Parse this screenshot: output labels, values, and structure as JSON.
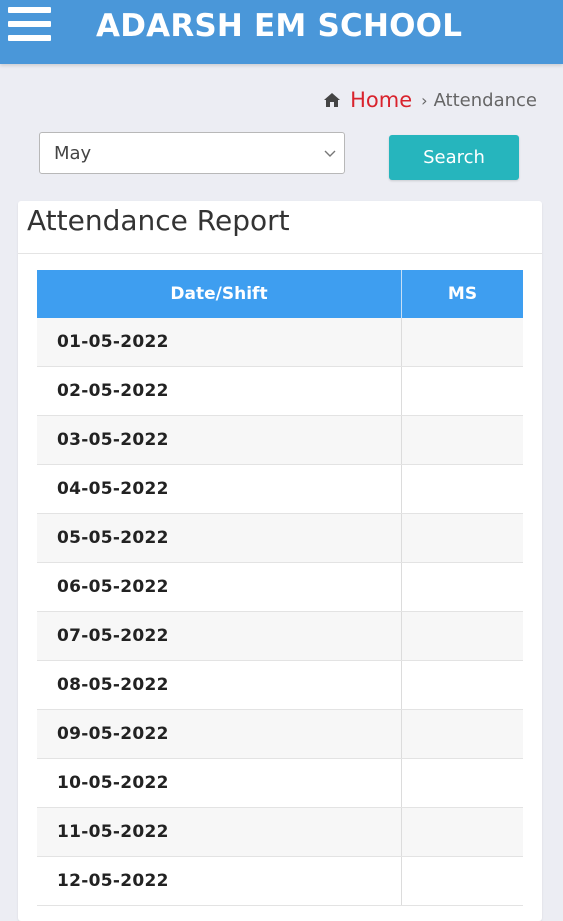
{
  "header": {
    "menu_icon": "hamburger-menu-icon",
    "title": "ADARSH EM SCHOOL",
    "background_color": "#4a97d9"
  },
  "breadcrumb": {
    "home_icon": "home-icon",
    "home_label": "Home",
    "separator": "›",
    "current": "Attendance",
    "home_color": "#d9232d"
  },
  "filter": {
    "month_value": "May",
    "search_label": "Search",
    "search_color": "#26b5bd"
  },
  "report": {
    "title": "Attendance Report",
    "columns": [
      "Date/Shift",
      "MS"
    ],
    "header_color": "#3e9ef0",
    "rows": [
      {
        "date": "01-05-2022",
        "ms": ""
      },
      {
        "date": "02-05-2022",
        "ms": ""
      },
      {
        "date": "03-05-2022",
        "ms": ""
      },
      {
        "date": "04-05-2022",
        "ms": ""
      },
      {
        "date": "05-05-2022",
        "ms": ""
      },
      {
        "date": "06-05-2022",
        "ms": ""
      },
      {
        "date": "07-05-2022",
        "ms": ""
      },
      {
        "date": "08-05-2022",
        "ms": ""
      },
      {
        "date": "09-05-2022",
        "ms": ""
      },
      {
        "date": "10-05-2022",
        "ms": ""
      },
      {
        "date": "11-05-2022",
        "ms": ""
      },
      {
        "date": "12-05-2022",
        "ms": ""
      }
    ]
  }
}
